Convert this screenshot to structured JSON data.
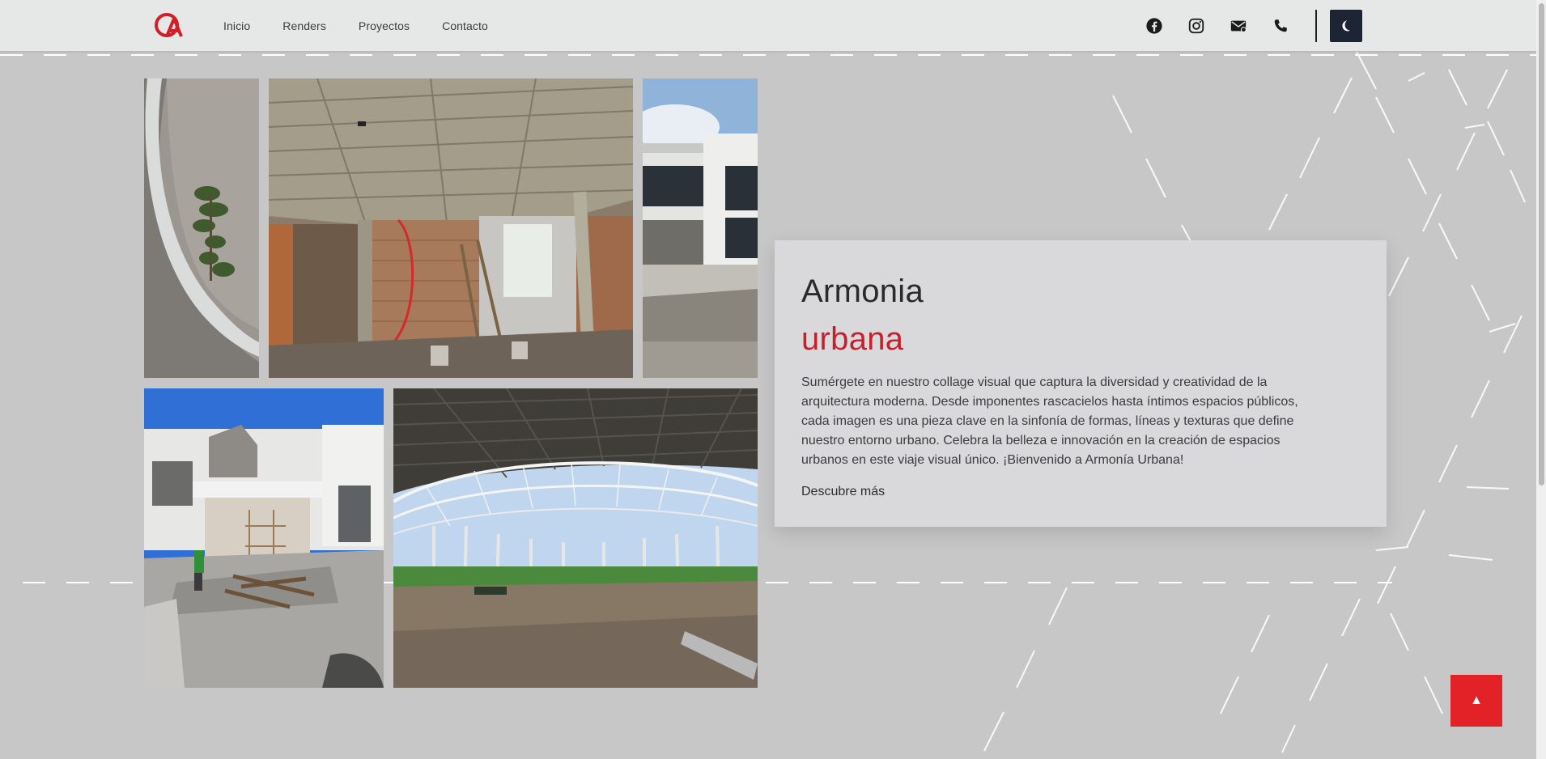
{
  "nav": {
    "logo_icon": "logo-icon",
    "links": [
      "Inicio",
      "Renders",
      "Proyectos",
      "Contacto"
    ],
    "icons": [
      "facebook-icon",
      "instagram-icon",
      "mail-icon",
      "phone-icon"
    ],
    "theme_toggle_icon": "moon-icon"
  },
  "gallery": {
    "photos": [
      "curved-wall-with-plant",
      "concrete-ceiling-brick-construction",
      "modern-house-facade",
      "white-house-under-construction",
      "steel-roof-structure"
    ]
  },
  "card": {
    "title": "Armonia",
    "subtitle": "urbana",
    "text": "Sumérgete en nuestro collage visual que captura la diversidad y creatividad de la arquitectura moderna. Desde imponentes rascacielos hasta íntimos espacios públicos, cada imagen es una pieza clave en la sinfonía de formas, líneas y texturas que define nuestro entorno urbano. Celebra la belleza e innovación en la creación de espacios urbanos en este viaje visual único. ¡Bienvenido a Armonía Urbana!",
    "link": "Descubre más"
  },
  "back_to_top": {
    "label": "▲"
  },
  "colors": {
    "accent": "#e32227",
    "subtitle": "#c8202a",
    "background": "#c7c7c8",
    "navbar": "#e6e7e7",
    "theme_button": "#1d2433"
  }
}
